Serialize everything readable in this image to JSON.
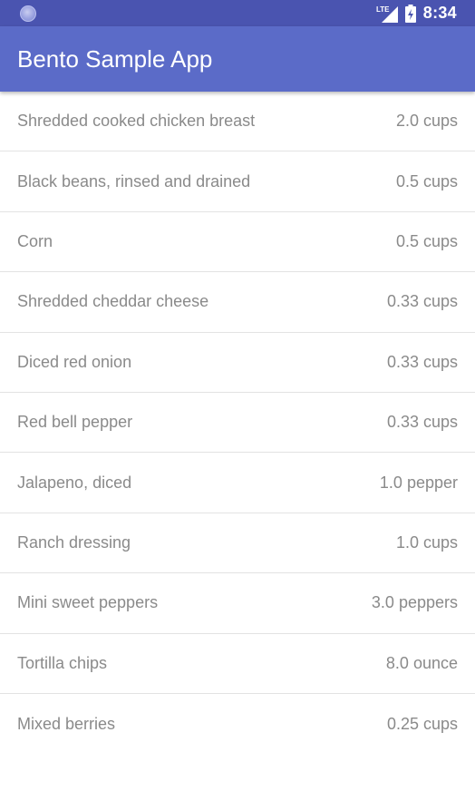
{
  "status_bar": {
    "time": "8:34",
    "network_label": "LTE",
    "icons": [
      "notification-dot-icon",
      "lte-signal-icon",
      "battery-charging-icon"
    ],
    "background_color": "#4a54b0"
  },
  "app_bar": {
    "title": "Bento Sample App",
    "background_color": "#5b6bc8"
  },
  "ingredients": [
    {
      "name": "Shredded cooked chicken breast",
      "quantity": "2.0 cups"
    },
    {
      "name": "Black beans, rinsed and drained",
      "quantity": "0.5 cups"
    },
    {
      "name": "Corn",
      "quantity": "0.5 cups"
    },
    {
      "name": "Shredded cheddar cheese",
      "quantity": "0.33 cups"
    },
    {
      "name": "Diced red onion",
      "quantity": "0.33 cups"
    },
    {
      "name": "Red bell pepper",
      "quantity": "0.33 cups"
    },
    {
      "name": "Jalapeno, diced",
      "quantity": "1.0 pepper"
    },
    {
      "name": "Ranch dressing",
      "quantity": "1.0 cups"
    },
    {
      "name": "Mini sweet peppers",
      "quantity": "3.0 peppers"
    },
    {
      "name": "Tortilla chips",
      "quantity": "8.0 ounce"
    },
    {
      "name": "Mixed berries",
      "quantity": "0.25 cups"
    }
  ]
}
